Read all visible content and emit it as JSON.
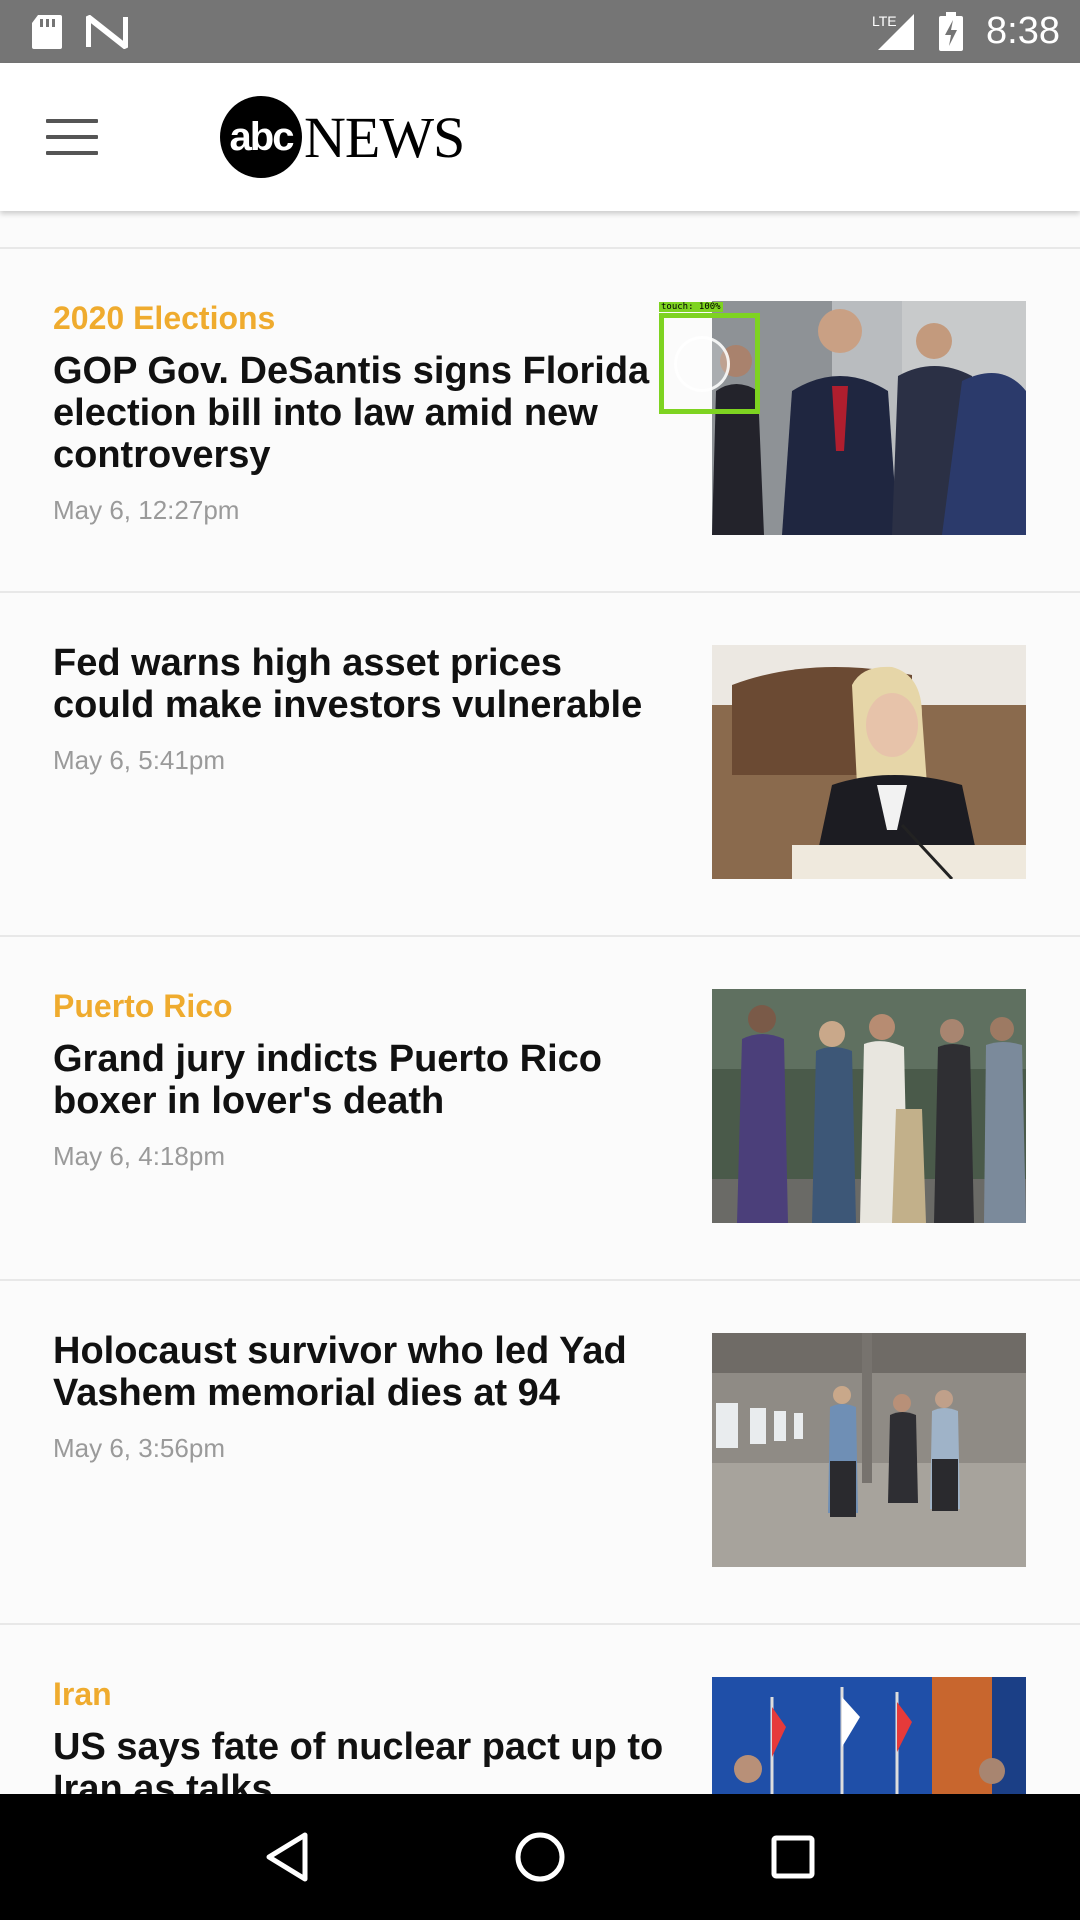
{
  "status_bar": {
    "time": "8:38",
    "network": "LTE",
    "left_icons": [
      "sd-card-icon",
      "n-notification-icon"
    ],
    "right_icons": [
      "signal-icon",
      "battery-charging-icon"
    ]
  },
  "header": {
    "logo_abc": "abc",
    "logo_news": "NEWS"
  },
  "touch_overlay": {
    "label": "touch: 100%"
  },
  "stories": [
    {
      "category": "2020 Elections",
      "headline": "GOP Gov. DeSantis signs Florida election bill into law amid new controversy",
      "timestamp": "May 6, 12:27pm",
      "thumbnail": "desantis-photo"
    },
    {
      "category": "",
      "headline": "Fed warns high asset prices could make investors vulnerable",
      "timestamp": "May 6, 5:41pm",
      "thumbnail": "fed-official-photo"
    },
    {
      "category": "Puerto Rico",
      "headline": "Grand jury indicts Puerto Rico boxer in lover's death",
      "timestamp": "May 6, 4:18pm",
      "thumbnail": "crowd-photo"
    },
    {
      "category": "",
      "headline": "Holocaust survivor who led Yad Vashem memorial dies at 94",
      "timestamp": "May 6, 3:56pm",
      "thumbnail": "building-interior-photo"
    },
    {
      "category": "Iran",
      "headline": "US says fate of nuclear pact up to Iran as talks",
      "timestamp": "",
      "thumbnail": "flags-press-photo"
    }
  ],
  "nav_bar": {
    "buttons": [
      "back-icon",
      "home-icon",
      "recents-icon"
    ]
  },
  "colors": {
    "category_accent": "#efab2e",
    "status_bar": "#757575",
    "nav_bar": "#000000"
  }
}
